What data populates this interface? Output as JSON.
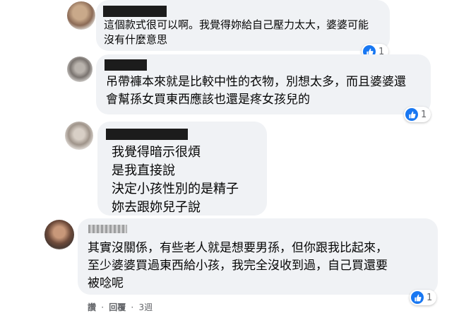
{
  "comments": [
    {
      "text": "這個款式很可以啊。我覺得妳給自己壓力太大，婆婆可能\n沒有什麼意思",
      "reactions": {
        "count": "1"
      }
    },
    {
      "text": "吊帶褲本來就是比較中性的衣物，別想太多，而且婆婆還\n會幫孫女買東西應該也還是疼女孩兒的",
      "reactions": {
        "count": "1"
      }
    },
    {
      "text": "我覺得暗示很煩\n是我直接說\n決定小孩性別的是精子\n妳去跟妳兒子說"
    },
    {
      "text": "其實沒關係，有些老人就是想要男孫，但你跟我比起來，\n至少婆婆買過東西給小孩，我完全沒收到過，自己買還要\n被唸呢",
      "reactions": {
        "count": "1"
      },
      "actions": {
        "like": "讚",
        "sep1": "·",
        "reply": "回覆",
        "sep2": "·",
        "time": "3週"
      }
    }
  ],
  "colors": {
    "bubble": "#f0f2f5",
    "like_blue": "#1877f2",
    "meta_gray": "#65676b"
  }
}
